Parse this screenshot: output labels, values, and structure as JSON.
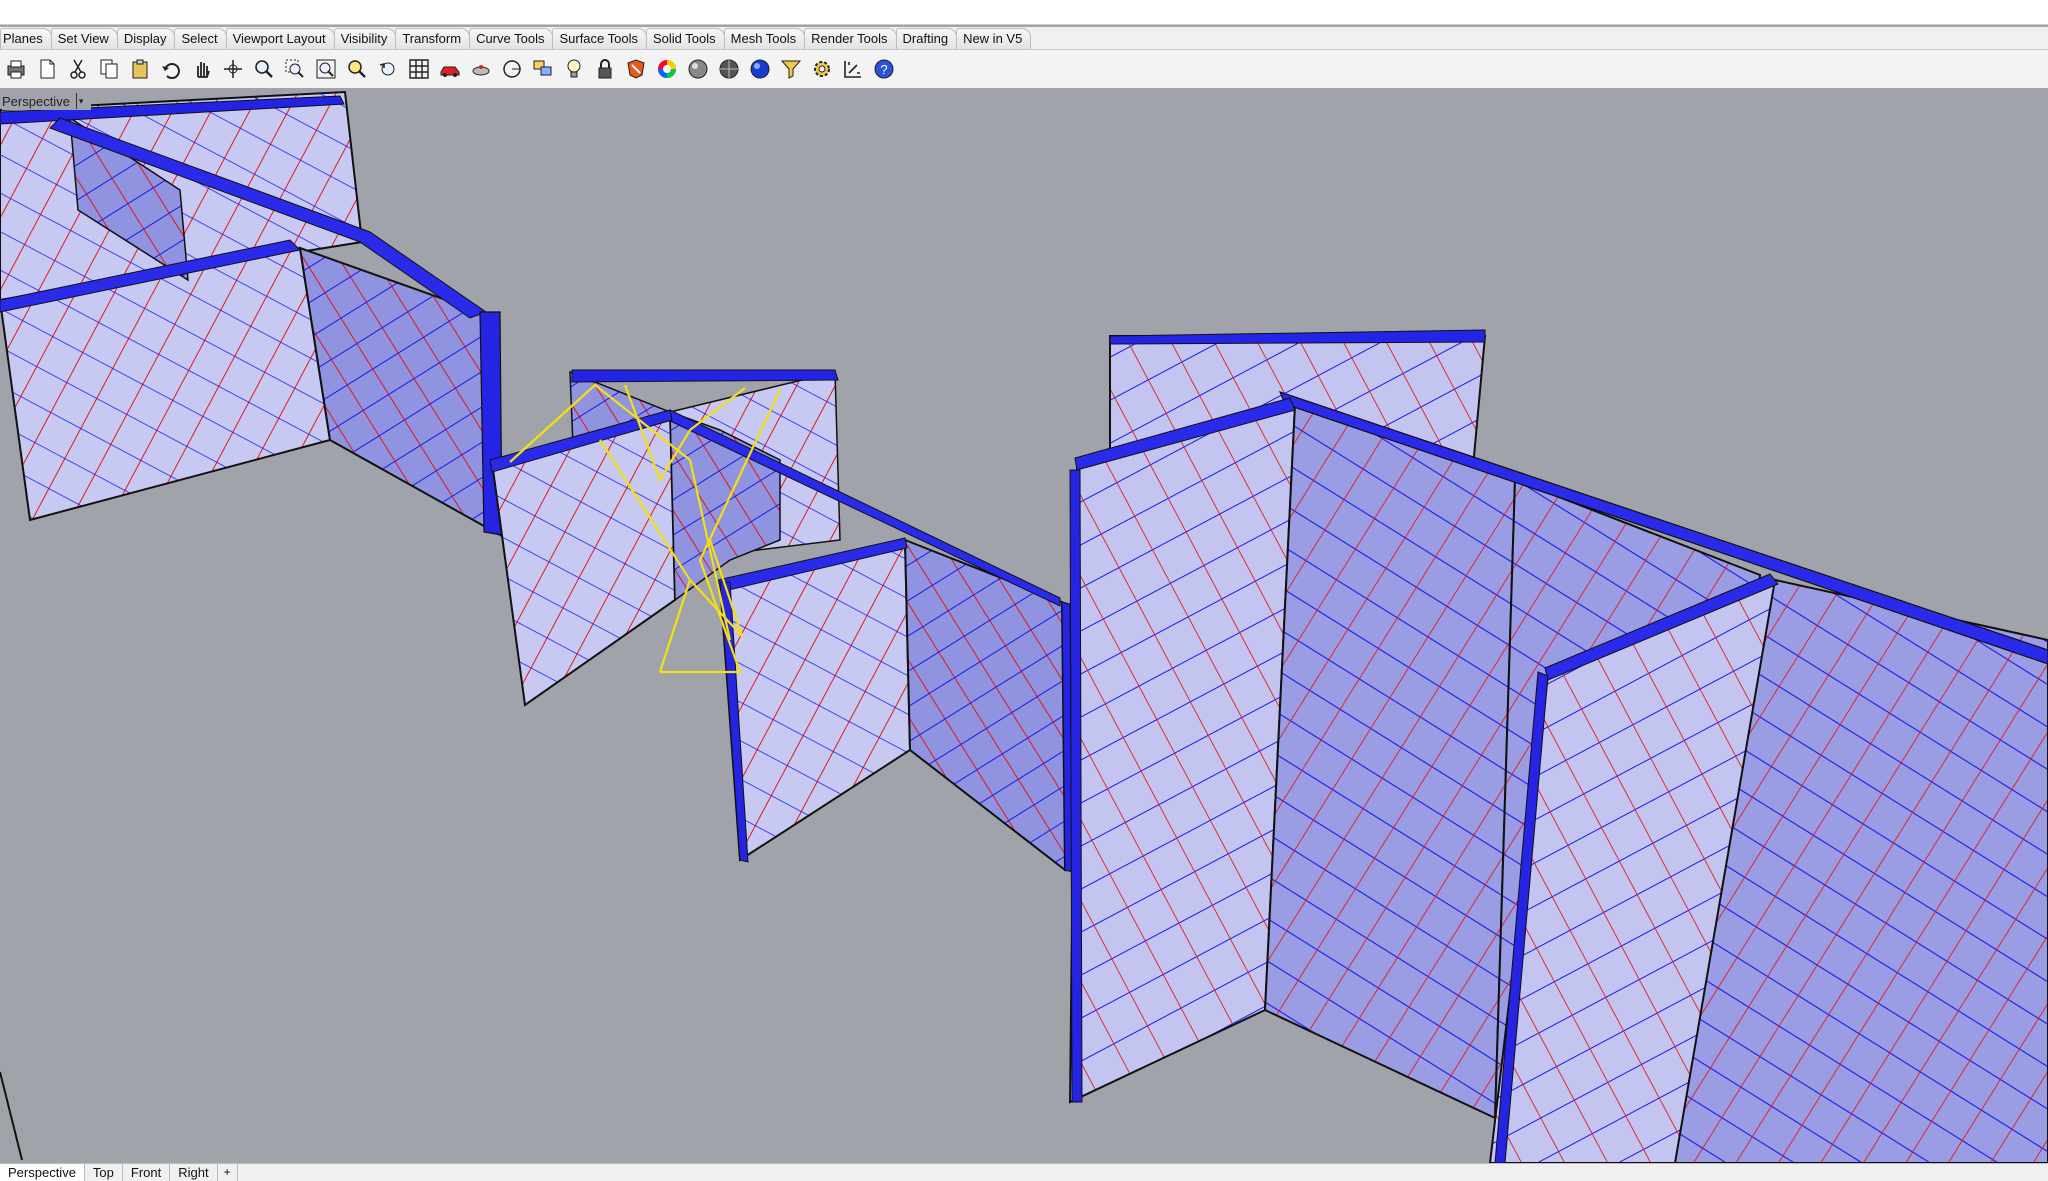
{
  "menu_tabs": [
    "Planes",
    "Set View",
    "Display",
    "Select",
    "Viewport Layout",
    "Visibility",
    "Transform",
    "Curve Tools",
    "Surface Tools",
    "Solid Tools",
    "Mesh Tools",
    "Render Tools",
    "Drafting",
    "New in V5"
  ],
  "toolbar_icons": [
    "print-icon",
    "new-document-icon",
    "cut-icon",
    "copy-icon",
    "paste-icon",
    "undo-icon",
    "pan-hand-icon",
    "rotate-view-icon",
    "zoom-icon",
    "zoom-window-icon",
    "zoom-extents-icon",
    "zoom-selected-icon",
    "undo-view-icon",
    "grid-icon",
    "car-icon",
    "object-snap-icon",
    "circle-icon",
    "layers-icon",
    "light-bulb-icon",
    "lock-icon",
    "shield-icon",
    "color-wheel-icon",
    "render-sphere-icon",
    "shaded-sphere-icon",
    "material-sphere-icon",
    "filter-icon",
    "gear-icon",
    "dimension-icon",
    "help-icon"
  ],
  "viewport": {
    "label": "Perspective",
    "dropdown": "▾"
  },
  "colors": {
    "viewport_bg": "#a0a4aa",
    "panel_face": "#c7c9f2",
    "panel_edge_dark": "#1f1fe0",
    "hatch_red": "#e01818",
    "hatch_blue": "#1a1ae6",
    "highlight_yellow": "#f2e011"
  },
  "view_tabs": [
    "Perspective",
    "Top",
    "Front",
    "Right"
  ],
  "add_tab": "+"
}
